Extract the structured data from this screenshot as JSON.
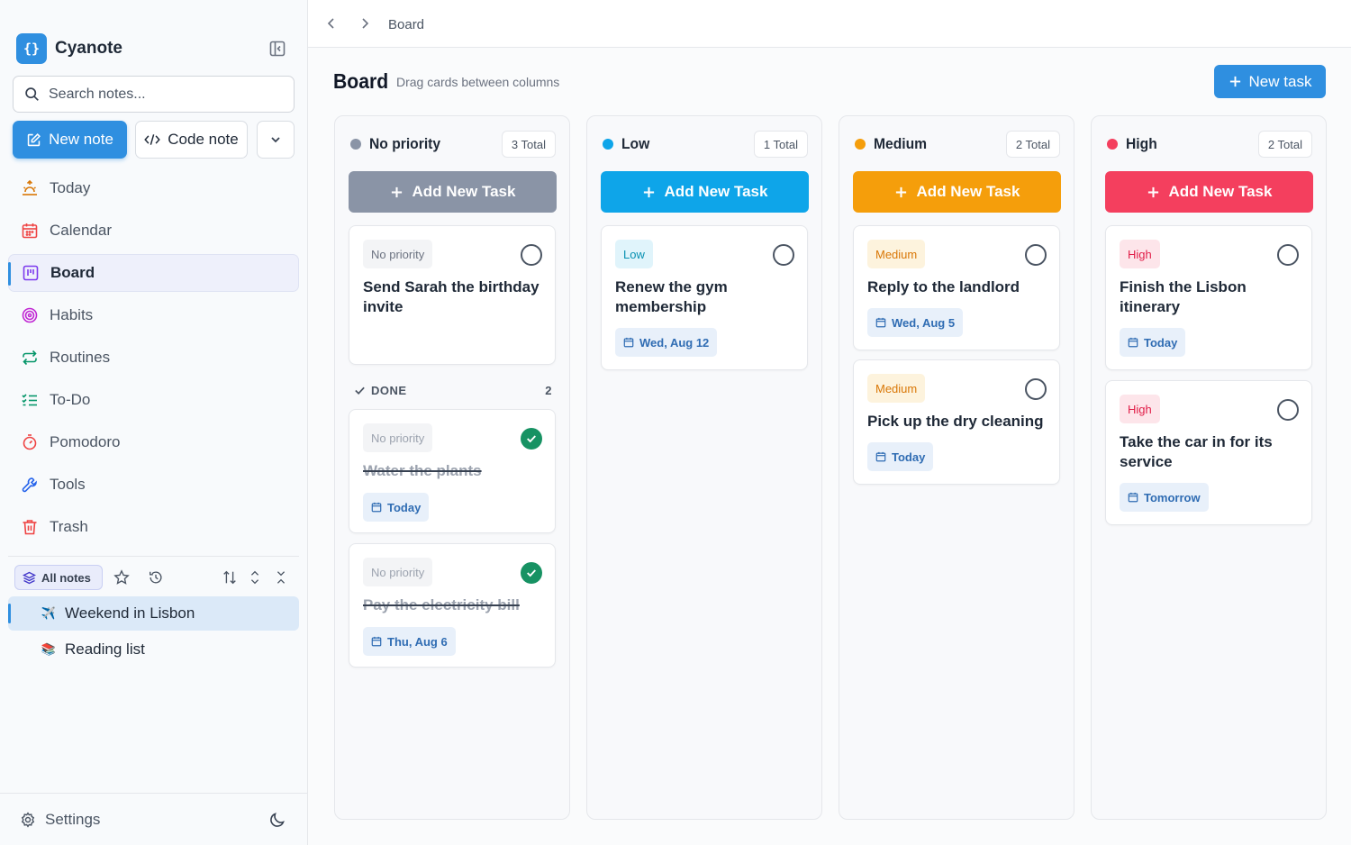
{
  "app": {
    "name": "Cyanote",
    "logo": "{}"
  },
  "sidebar": {
    "search_placeholder": "Search notes...",
    "new_note": "New note",
    "code_note": "Code note",
    "nav": [
      {
        "label": "Today",
        "icon": "sunrise-icon",
        "color": "#d97706"
      },
      {
        "label": "Calendar",
        "icon": "calendar-icon",
        "color": "#ef4444"
      },
      {
        "label": "Board",
        "icon": "board-icon",
        "color": "#7c3aed"
      },
      {
        "label": "Habits",
        "icon": "target-icon",
        "color": "#c026d3"
      },
      {
        "label": "Routines",
        "icon": "repeat-icon",
        "color": "#059669"
      },
      {
        "label": "To-Do",
        "icon": "checklist-icon",
        "color": "#059669"
      },
      {
        "label": "Pomodoro",
        "icon": "timer-icon",
        "color": "#ef4444"
      },
      {
        "label": "Tools",
        "icon": "wrench-icon",
        "color": "#2563eb"
      },
      {
        "label": "Trash",
        "icon": "trash-icon",
        "color": "#ef4444"
      }
    ],
    "active_nav": "Board",
    "notes_filter": "All notes",
    "notes": [
      {
        "title": "Weekend in Lisbon",
        "emoji": "✈️",
        "active": true
      },
      {
        "title": "Reading list",
        "emoji": "📚",
        "active": false
      }
    ],
    "settings": "Settings"
  },
  "topbar": {
    "breadcrumb": "Board"
  },
  "page": {
    "title": "Board",
    "subtitle": "Drag cards between columns",
    "new_task": "New task"
  },
  "columns": [
    {
      "title": "No priority",
      "count": "3 Total",
      "color": "#8a94a6",
      "add_color": "#8a94a6",
      "add_label": "Add New Task",
      "cards": [
        {
          "badge": "No priority",
          "title": "Send Sarah the birthday invite",
          "date": ""
        }
      ],
      "done_label": "DONE",
      "done_count": "2",
      "done_cards": [
        {
          "badge": "No priority",
          "title": "Water the plants",
          "date": "Today"
        },
        {
          "badge": "No priority",
          "title": "Pay the electricity bill",
          "date": "Thu, Aug 6"
        }
      ]
    },
    {
      "title": "Low",
      "count": "1 Total",
      "color": "#0ea5e9",
      "add_color": "#0ea5e9",
      "add_label": "Add New Task",
      "cards": [
        {
          "badge": "Low",
          "title": "Renew the gym membership",
          "date": "Wed, Aug 12"
        }
      ]
    },
    {
      "title": "Medium",
      "count": "2 Total",
      "color": "#f59e0b",
      "add_color": "#f59e0b",
      "add_label": "Add New Task",
      "cards": [
        {
          "badge": "Medium",
          "title": "Reply to the landlord",
          "date": "Wed, Aug 5"
        },
        {
          "badge": "Medium",
          "title": "Pick up the dry cleaning",
          "date": "Today"
        }
      ]
    },
    {
      "title": "High",
      "count": "2 Total",
      "color": "#f43f5e",
      "add_color": "#f43f5e",
      "add_label": "Add New Task",
      "cards": [
        {
          "badge": "High",
          "title": "Finish the Lisbon itinerary",
          "date": "Today"
        },
        {
          "badge": "High",
          "title": "Take the car in for its service",
          "date": "Tomorrow"
        }
      ]
    }
  ]
}
